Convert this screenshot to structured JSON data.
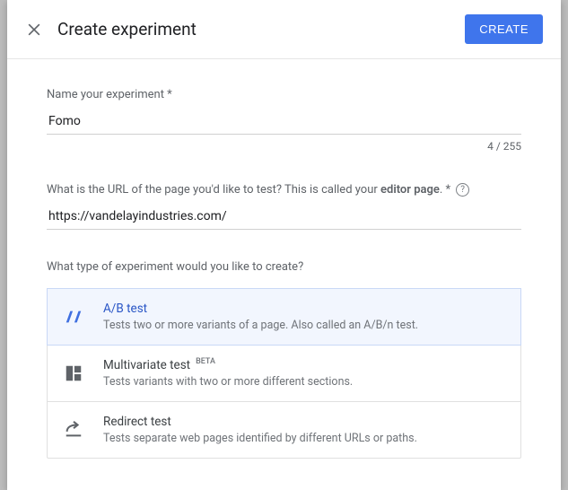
{
  "header": {
    "title": "Create experiment",
    "create_label": "CREATE"
  },
  "name_field": {
    "label": "Name your experiment *",
    "value": "Fomo",
    "counter": "4 / 255"
  },
  "url_field": {
    "label_pre": "What is the URL of the page you'd like to test? This is called your ",
    "label_bold": "editor page",
    "label_post": ". *",
    "value": "https://vandelayindustries.com/"
  },
  "type": {
    "label": "What type of experiment would you like to create?",
    "options": [
      {
        "title": "A/B test",
        "desc": "Tests two or more variants of a page. Also called an A/B/n test.",
        "beta": ""
      },
      {
        "title": "Multivariate test",
        "desc": "Tests variants with two or more different sections.",
        "beta": "BETA"
      },
      {
        "title": "Redirect test",
        "desc": "Tests separate web pages identified by different URLs or paths.",
        "beta": ""
      }
    ]
  }
}
